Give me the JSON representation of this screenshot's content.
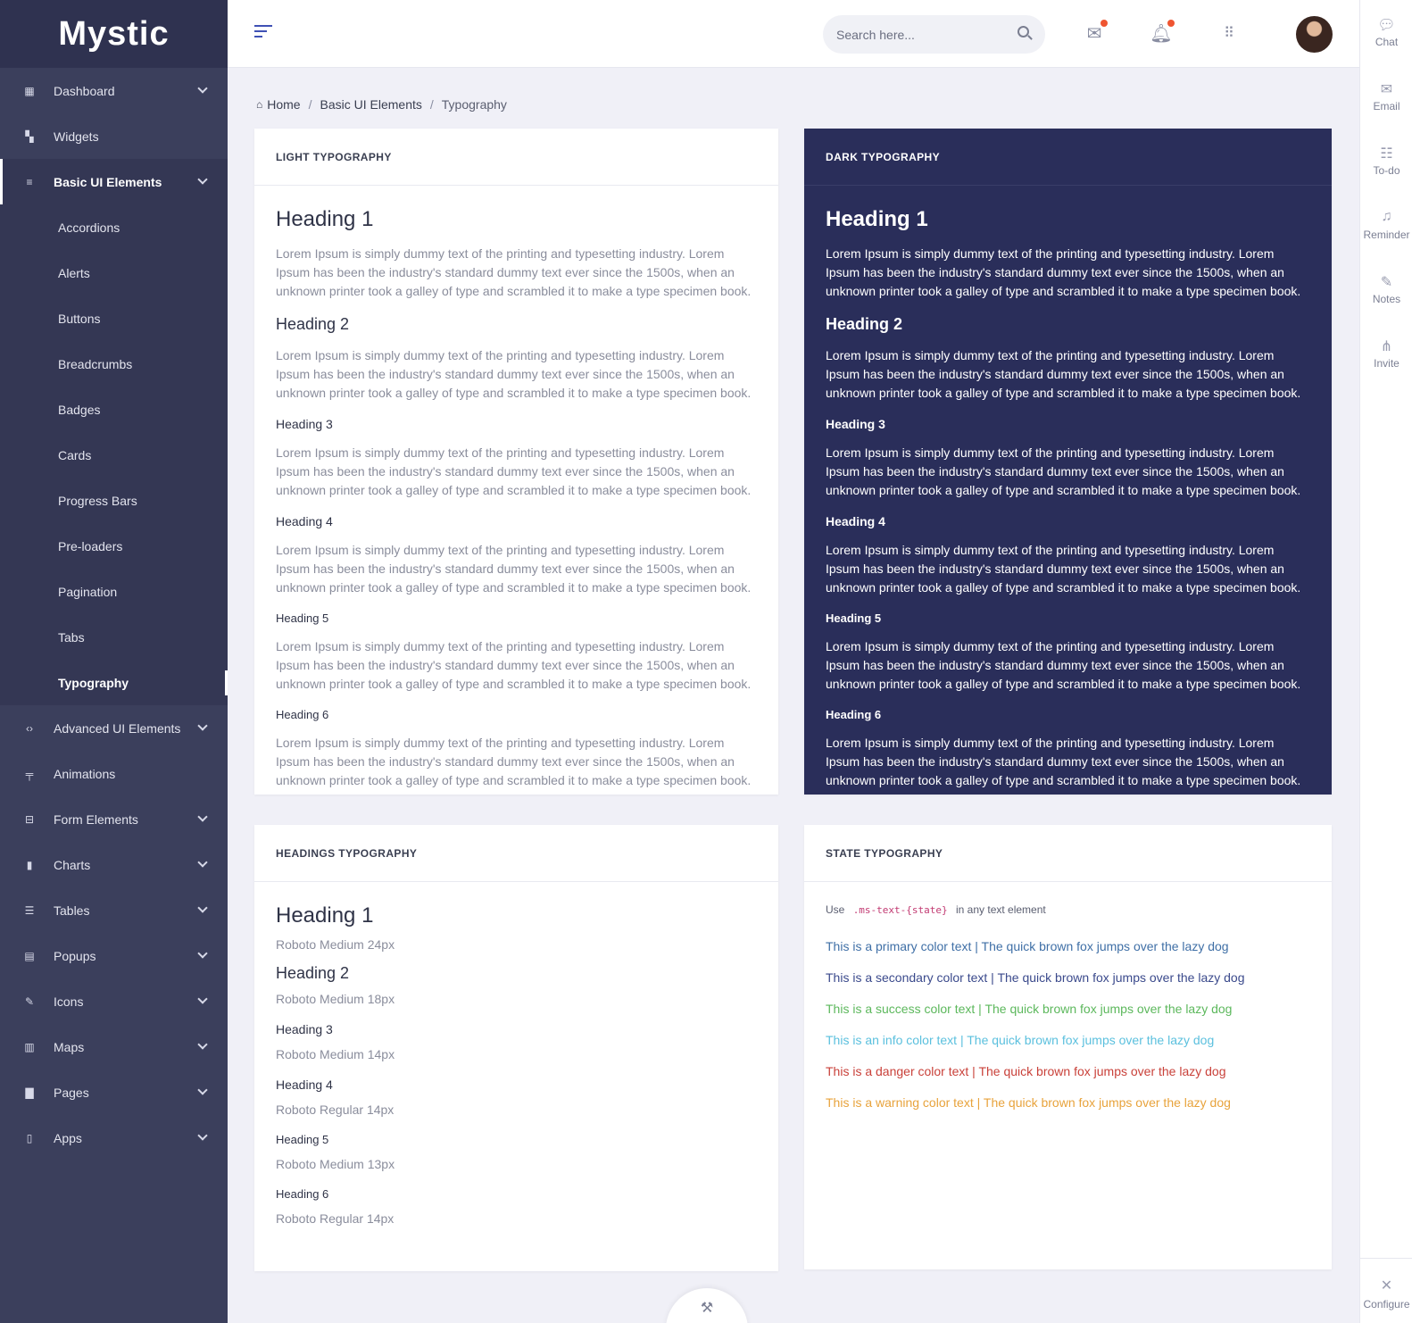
{
  "brand": {
    "logo": "Mystic"
  },
  "sidebar": {
    "items": [
      {
        "label": "Dashboard",
        "icon": "dashboard-icon"
      },
      {
        "label": "Widgets",
        "icon": "widgets-icon"
      },
      {
        "label": "Basic UI Elements",
        "icon": "basic-ui-icon"
      },
      {
        "label": "Advanced UI Elements",
        "icon": "code-icon"
      },
      {
        "label": "Animations",
        "icon": "paint-roller-icon"
      },
      {
        "label": "Form Elements",
        "icon": "form-icon"
      },
      {
        "label": "Charts",
        "icon": "bar-chart-icon"
      },
      {
        "label": "Tables",
        "icon": "sliders-icon"
      },
      {
        "label": "Popups",
        "icon": "comment-icon"
      },
      {
        "label": "Icons",
        "icon": "pencil-icon"
      },
      {
        "label": "Maps",
        "icon": "map-icon"
      },
      {
        "label": "Pages",
        "icon": "file-icon"
      },
      {
        "label": "Apps",
        "icon": "mobile-icon"
      }
    ],
    "subitems": [
      "Accordions",
      "Alerts",
      "Buttons",
      "Breadcrumbs",
      "Badges",
      "Cards",
      "Progress Bars",
      "Pre-loaders",
      "Pagination",
      "Tabs",
      "Typography"
    ]
  },
  "header": {
    "search_placeholder": "Search here..."
  },
  "right_panel": {
    "items": [
      "Chat",
      "Email",
      "To-do",
      "Reminder",
      "Notes",
      "Invite"
    ],
    "configure": "Configure"
  },
  "breadcrumb": {
    "home": "Home",
    "section": "Basic UI Elements",
    "current": "Typography"
  },
  "lorem": "Lorem Ipsum is simply dummy text of the printing and typesetting industry. Lorem Ipsum has been the industry's standard dummy text ever since the 1500s, when an unknown printer took a galley of type and scrambled it to make a type specimen book.",
  "light_card": {
    "title": "LIGHT TYPOGRAPHY",
    "headings": [
      "Heading 1",
      "Heading 2",
      "Heading 3",
      "Heading 4",
      "Heading 5",
      "Heading 6"
    ]
  },
  "dark_card": {
    "title": "DARK TYPOGRAPHY",
    "headings": [
      "Heading 1",
      "Heading 2",
      "Heading 3",
      "Heading 4",
      "Heading 5",
      "Heading 6"
    ]
  },
  "headings_card": {
    "title": "HEADINGS TYPOGRAPHY",
    "items": [
      {
        "heading": "Heading 1",
        "desc": "Roboto Medium 24px"
      },
      {
        "heading": "Heading 2",
        "desc": "Roboto Medium 18px"
      },
      {
        "heading": "Heading 3",
        "desc": "Roboto Medium 14px"
      },
      {
        "heading": "Heading 4",
        "desc": "Roboto Regular 14px"
      },
      {
        "heading": "Heading 5",
        "desc": "Roboto Medium 13px"
      },
      {
        "heading": "Heading 6",
        "desc": "Roboto Regular 14px"
      }
    ]
  },
  "state_card": {
    "title": "STATE TYPOGRAPHY",
    "intro_pre": "Use",
    "intro_code": ".ms-text-{state}",
    "intro_post": "in any text element",
    "lines": [
      {
        "text": "This is a primary color text | The quick brown fox jumps over the lazy dog",
        "color": "#3f6fa6"
      },
      {
        "text": "This is a secondary color text | The quick brown fox jumps over the lazy dog",
        "color": "#3b4a8c"
      },
      {
        "text": "This is a success color text | The quick brown fox jumps over the lazy dog",
        "color": "#5cb85c"
      },
      {
        "text": "This is an info color text | The quick brown fox jumps over the lazy dog",
        "color": "#5bc0de"
      },
      {
        "text": "This is a danger color text | The quick brown fox jumps over the lazy dog",
        "color": "#c9413a"
      },
      {
        "text": "This is a warning color text | The quick brown fox jumps over the lazy dog",
        "color": "#e8a33c"
      }
    ]
  }
}
